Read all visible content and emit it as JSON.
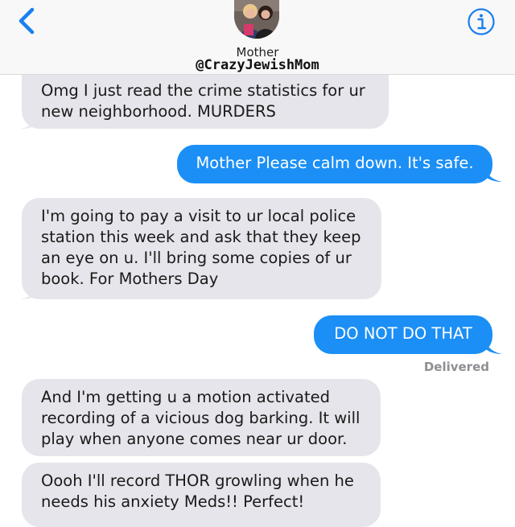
{
  "header": {
    "contact_name": "Mother",
    "overlay_handle": "@CrazyJewishMom",
    "back_icon": "chevron-left-icon",
    "info_icon": "info-icon"
  },
  "colors": {
    "incoming_bubble": "#e6e5eb",
    "outgoing_bubble": "#1b8ff5",
    "accent": "#1a7ff0"
  },
  "messages": [
    {
      "direction": "incoming",
      "text": "Omg I just read the crime statistics for ur new neighborhood. MURDERS"
    },
    {
      "direction": "outgoing",
      "text": "Mother Please calm down. It's safe."
    },
    {
      "direction": "incoming",
      "text": "I'm going to pay a visit to ur local police station this week and ask that they keep an eye on u. I'll bring some copies of ur book. For Mothers Day"
    },
    {
      "direction": "outgoing",
      "text": "DO NOT DO THAT"
    },
    {
      "direction": "incoming",
      "text": "And I'm getting u a motion activated recording of a vicious dog barking. It will play when anyone  comes near ur door."
    },
    {
      "direction": "incoming",
      "text": "Oooh I'll record THOR growling when he needs his anxiety Meds!! Perfect!"
    }
  ],
  "status": "Delivered"
}
